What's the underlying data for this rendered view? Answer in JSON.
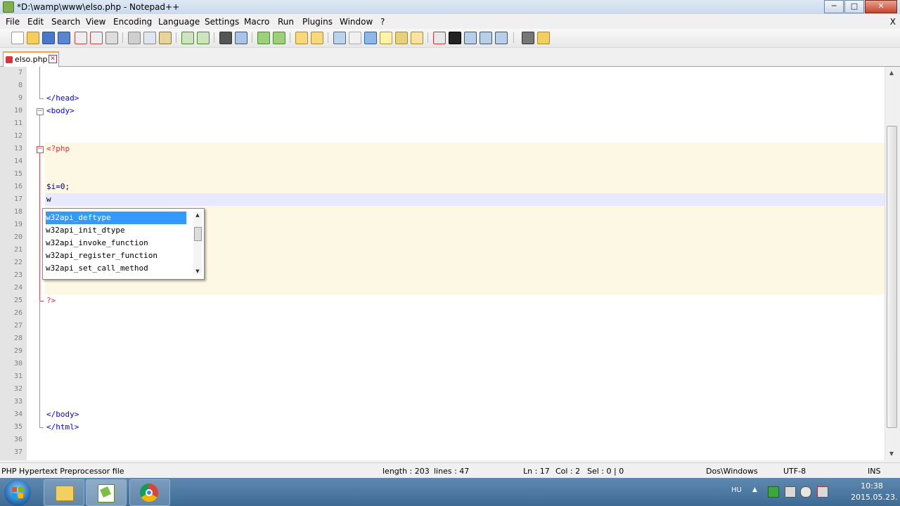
{
  "window": {
    "title": "*D:\\wamp\\www\\elso.php - Notepad++",
    "minimize": "─",
    "maximize": "□",
    "close": "✕"
  },
  "menu": {
    "items": [
      "File",
      "Edit",
      "Search",
      "View",
      "Encoding",
      "Language",
      "Settings",
      "Macro",
      "Run",
      "Plugins",
      "Window",
      "?"
    ],
    "close_doc": "X"
  },
  "tab": {
    "label": "elso.php",
    "close": "✕"
  },
  "editor": {
    "lines": [
      {
        "num": "7",
        "code": ""
      },
      {
        "num": "8",
        "code": ""
      },
      {
        "num": "9",
        "code": "</head>"
      },
      {
        "num": "10",
        "code": "<body>"
      },
      {
        "num": "11",
        "code": ""
      },
      {
        "num": "12",
        "code": ""
      },
      {
        "num": "13",
        "code": "<?php"
      },
      {
        "num": "14",
        "code": ""
      },
      {
        "num": "15",
        "code": ""
      },
      {
        "num": "16",
        "code": "$i=0;"
      },
      {
        "num": "17",
        "code": "w"
      },
      {
        "num": "18",
        "code": ""
      },
      {
        "num": "19",
        "code": ""
      },
      {
        "num": "20",
        "code": ""
      },
      {
        "num": "21",
        "code": ""
      },
      {
        "num": "22",
        "code": ""
      },
      {
        "num": "23",
        "code": ""
      },
      {
        "num": "24",
        "code": ""
      },
      {
        "num": "25",
        "code": "?>"
      },
      {
        "num": "26",
        "code": ""
      },
      {
        "num": "27",
        "code": ""
      },
      {
        "num": "28",
        "code": ""
      },
      {
        "num": "29",
        "code": ""
      },
      {
        "num": "30",
        "code": ""
      },
      {
        "num": "31",
        "code": ""
      },
      {
        "num": "32",
        "code": ""
      },
      {
        "num": "33",
        "code": ""
      },
      {
        "num": "34",
        "code": "</body>"
      },
      {
        "num": "35",
        "code": "</html>"
      },
      {
        "num": "36",
        "code": ""
      },
      {
        "num": "37",
        "code": ""
      }
    ]
  },
  "autocomplete": {
    "items": [
      "w32api_deftype",
      "w32api_init_dtype",
      "w32api_invoke_function",
      "w32api_register_function",
      "w32api_set_call_method"
    ],
    "selected_index": 0
  },
  "status": {
    "filetype": "PHP Hypertext Preprocessor file",
    "length": "length : 203",
    "lines": "lines : 47",
    "ln": "Ln : 17",
    "col": "Col : 2",
    "sel": "Sel : 0 | 0",
    "eol": "Dos\\Windows",
    "encoding": "UTF-8",
    "mode": "INS"
  },
  "taskbar": {
    "lang": "HU",
    "time": "10:38",
    "date": "2015.05.23."
  },
  "colors": {
    "php_tag": "#ff2a2a",
    "html_tag": "#0000ff",
    "selection": "#3399ff",
    "php_background": "#fdf8e3"
  }
}
